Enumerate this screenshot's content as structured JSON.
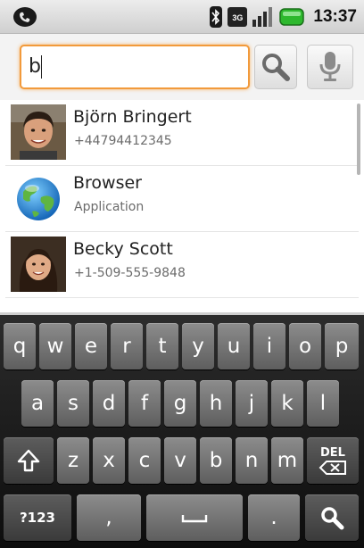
{
  "status_bar": {
    "time": "13:37",
    "icons": [
      "phone-call-icon",
      "bluetooth-icon",
      "3g-icon",
      "signal-icon",
      "battery-icon"
    ],
    "network_label": "3G"
  },
  "search": {
    "query": "b",
    "search_button_icon": "magnifier-icon",
    "voice_button_icon": "microphone-icon",
    "accent_color": "#f29a3b"
  },
  "suggestions": [
    {
      "title": "Björn Bringert",
      "subtitle": "+44794412345",
      "icon": "contact-photo"
    },
    {
      "title": "Browser",
      "subtitle": "Application",
      "icon": "globe-icon"
    },
    {
      "title": "Becky Scott",
      "subtitle": "+1-509-555-9848",
      "icon": "contact-photo"
    }
  ],
  "keyboard": {
    "row1": [
      "q",
      "w",
      "e",
      "r",
      "t",
      "y",
      "u",
      "i",
      "o",
      "p"
    ],
    "row2": [
      "a",
      "s",
      "d",
      "f",
      "g",
      "h",
      "j",
      "k",
      "l"
    ],
    "row3": [
      "z",
      "x",
      "c",
      "v",
      "b",
      "n",
      "m"
    ],
    "shift_icon": "shift-arrow-icon",
    "delete_label": "DEL",
    "symbols_label": "?123",
    "comma": ",",
    "period": ".",
    "space_icon": "space-bar-icon",
    "action_icon": "search-icon"
  }
}
